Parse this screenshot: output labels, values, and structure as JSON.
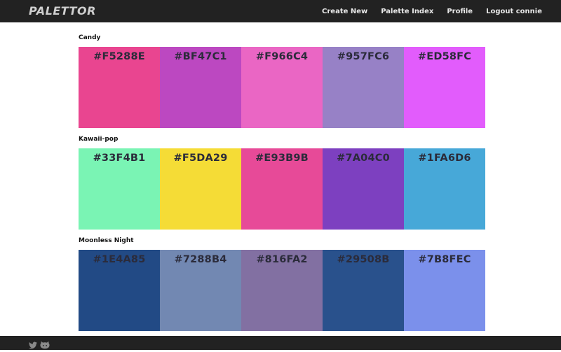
{
  "brand": "PALETTOR",
  "nav": [
    {
      "label": "Create New",
      "name": "nav-create-new"
    },
    {
      "label": "Palette Index",
      "name": "nav-palette-index"
    },
    {
      "label": "Profile",
      "name": "nav-profile"
    },
    {
      "label": "Logout connie",
      "name": "nav-logout"
    }
  ],
  "palettes": [
    {
      "name": "Candy",
      "colors": [
        "#F5288E",
        "#BF47C1",
        "#F966C4",
        "#957FC6",
        "#ED58FC"
      ],
      "display": [
        "#E94590",
        "#BC48C1",
        "#EA66C4",
        "#9781C6",
        "#E25CFC"
      ]
    },
    {
      "name": "Kawaii-pop",
      "colors": [
        "#33F4B1",
        "#F5DA29",
        "#E93B9B",
        "#7A04C0",
        "#1FA6D6"
      ],
      "display": [
        "#7AF4B4",
        "#F5DC36",
        "#E74A98",
        "#7D40C0",
        "#47A8D8"
      ]
    },
    {
      "name": "Moonless Night",
      "colors": [
        "#1E4A85",
        "#7288B4",
        "#816FA2",
        "#29508B",
        "#7B8FEC"
      ],
      "display": [
        "#224A85",
        "#7288B2",
        "#8270A2",
        "#29518C",
        "#7B90EB"
      ]
    }
  ],
  "footer_icons": [
    "twitter-icon",
    "github-icon"
  ],
  "colors": {
    "topbar": "#222222",
    "nav_text": "#e8e8e8",
    "brand_text": "#cfcfcf",
    "swatch_text": "#2b2b3a"
  }
}
